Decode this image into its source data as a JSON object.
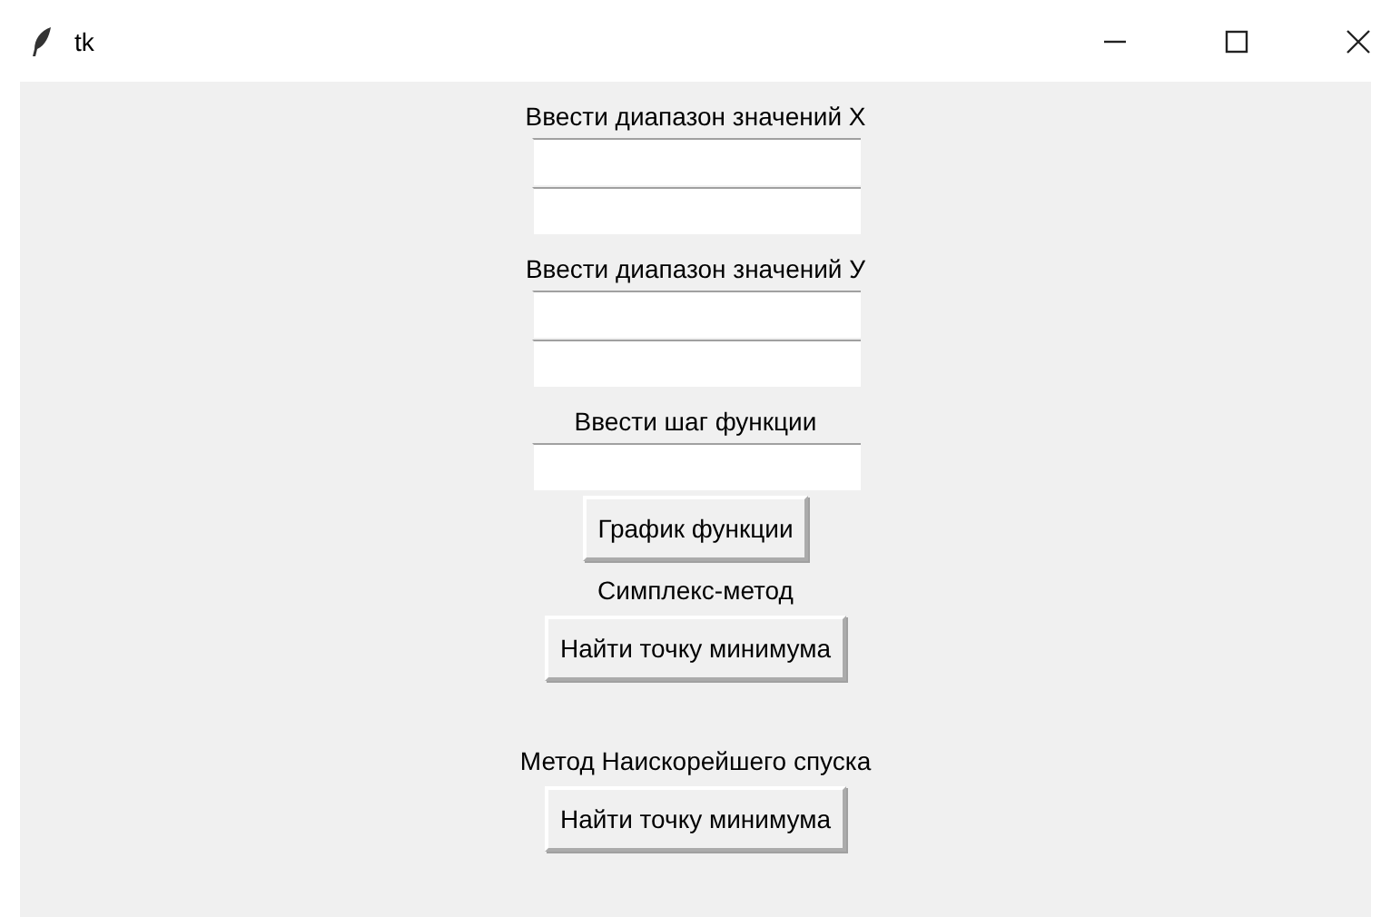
{
  "window": {
    "title": "tk"
  },
  "items": [
    {
      "kind": "label",
      "text": "Ввести диапазон значений X"
    },
    {
      "kind": "entry"
    },
    {
      "kind": "entry"
    },
    {
      "kind": "label",
      "text": "Ввести диапазон значений У"
    },
    {
      "kind": "entry"
    },
    {
      "kind": "entry"
    },
    {
      "kind": "label",
      "text": "Ввести шаг функции"
    },
    {
      "kind": "entry"
    },
    {
      "kind": "button",
      "text": "График функции"
    },
    {
      "kind": "label",
      "text": "Симплекс-метод"
    },
    {
      "kind": "button",
      "text": "Найти точку минимума"
    },
    {
      "kind": "spacer"
    },
    {
      "kind": "label",
      "text": "Метод Наискорейшего спуска"
    },
    {
      "kind": "button",
      "text": "Найти точку минимума"
    }
  ]
}
